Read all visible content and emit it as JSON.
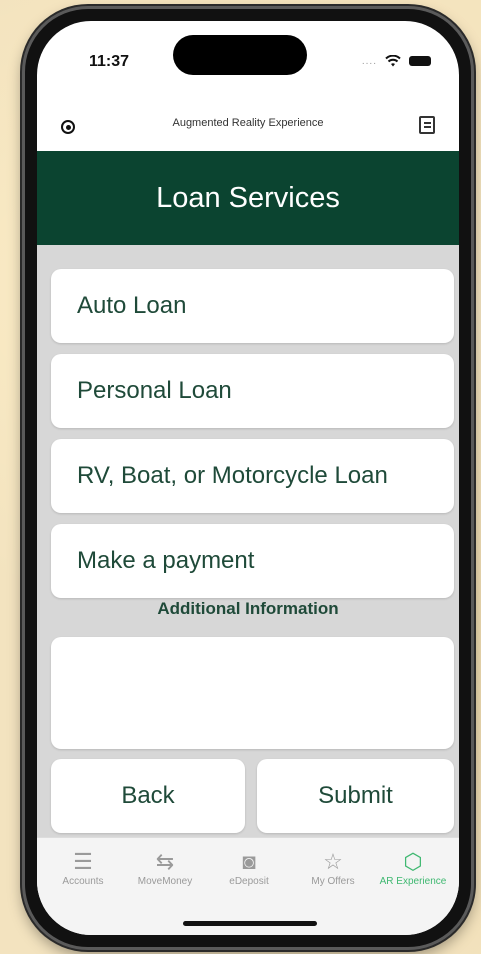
{
  "status": {
    "time": "11:37",
    "signal_dots": "...."
  },
  "top_bar": {
    "title": "Augmented Reality Experience"
  },
  "header": {
    "title": "Loan Services"
  },
  "options": [
    {
      "label": "Auto Loan"
    },
    {
      "label": "Personal Loan"
    },
    {
      "label": "RV, Boat, or Motorcycle Loan"
    },
    {
      "label": "Make a payment"
    }
  ],
  "additional_info": {
    "label": "Additional Information",
    "value": ""
  },
  "actions": {
    "back_label": "Back",
    "submit_label": "Submit"
  },
  "tabs": [
    {
      "label": "Accounts",
      "icon": "menu-icon",
      "glyph": "☰"
    },
    {
      "label": "MoveMoney",
      "icon": "transfer-arrows-icon",
      "glyph": "⇆"
    },
    {
      "label": "eDeposit",
      "icon": "camera-icon",
      "glyph": "◙"
    },
    {
      "label": "My Offers",
      "icon": "star-icon",
      "glyph": "☆"
    },
    {
      "label": "AR Experience",
      "icon": "ar-cube-icon",
      "glyph": "⬡"
    }
  ],
  "colors": {
    "brand_green": "#0b4430",
    "text_green": "#1f4a39",
    "active_tab": "#3fb871"
  }
}
